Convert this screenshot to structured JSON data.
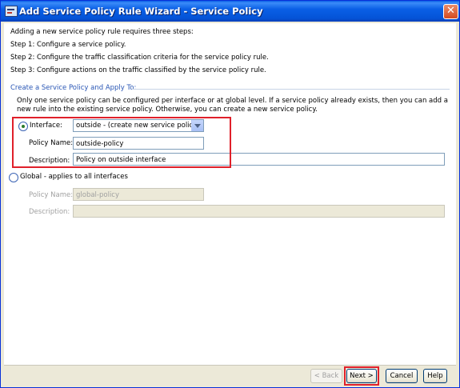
{
  "window": {
    "title": "Add Service Policy Rule Wizard - Service Policy",
    "close_glyph": "✕"
  },
  "intro": {
    "line1": "Adding a new service policy rule requires three steps:",
    "step1": "Step 1:  Configure a service policy.",
    "step2": "Step 2:  Configure the traffic classification criteria for the service policy rule.",
    "step3": "Step 3:  Configure actions on the traffic classified by the service policy rule."
  },
  "group": {
    "title": "Create a Service Policy and Apply To:",
    "note": "Only one service policy can be configured per interface or at global level. If a service policy already exists, then you can add a new rule into the existing service policy. Otherwise, you can create a new service policy."
  },
  "interface_option": {
    "label": "Interface:",
    "selected": true,
    "dropdown_value": "outside - (create new service policy)",
    "policy_name_label": "Policy Name:",
    "policy_name_value": "outside-policy",
    "description_label": "Description:",
    "description_value": "Policy on outside interface"
  },
  "global_option": {
    "label": "Global - applies to all interfaces",
    "selected": false,
    "policy_name_label": "Policy Name:",
    "policy_name_value": "global-policy",
    "description_label": "Description:",
    "description_value": ""
  },
  "buttons": {
    "back": "< Back",
    "next": "Next >",
    "cancel": "Cancel",
    "help": "Help"
  },
  "colors": {
    "titlebar": "#0a5fe6",
    "highlight": "#e0202a",
    "group_title": "#2956b5"
  }
}
